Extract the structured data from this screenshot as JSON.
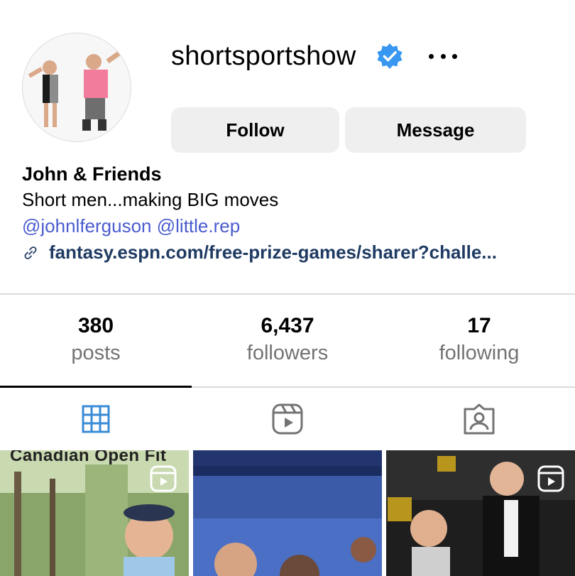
{
  "profile": {
    "username": "shortsportshow",
    "verified": true,
    "more_icon": "more-horizontal-icon",
    "avatar_icon": "profile-photo"
  },
  "actions": {
    "follow_label": "Follow",
    "message_label": "Message"
  },
  "bio": {
    "name": "John & Friends",
    "text": "Short men...making BIG moves",
    "mentions": [
      "@johnlferguson",
      "@little.rep"
    ],
    "link": "fantasy.espn.com/free-prize-games/sharer?challe...",
    "link_icon": "link-icon"
  },
  "stats": [
    {
      "value": "380",
      "label": "posts"
    },
    {
      "value": "6,437",
      "label": "followers"
    },
    {
      "value": "17",
      "label": "following"
    }
  ],
  "tabs": [
    {
      "icon": "grid-icon",
      "active": true
    },
    {
      "icon": "reels-icon",
      "active": false
    },
    {
      "icon": "tagged-icon",
      "active": false
    }
  ],
  "posts": [
    {
      "caption": "Canadian Open Fit",
      "type": "reel"
    },
    {
      "caption": "",
      "type": "image"
    },
    {
      "caption": "",
      "type": "reel"
    }
  ],
  "colors": {
    "verified_blue": "#3897f0",
    "mention_blue": "#4a5ccf",
    "link_navy": "#1f3b63",
    "button_gray": "#efefef",
    "active_tab_blue": "#3a8bd6"
  }
}
